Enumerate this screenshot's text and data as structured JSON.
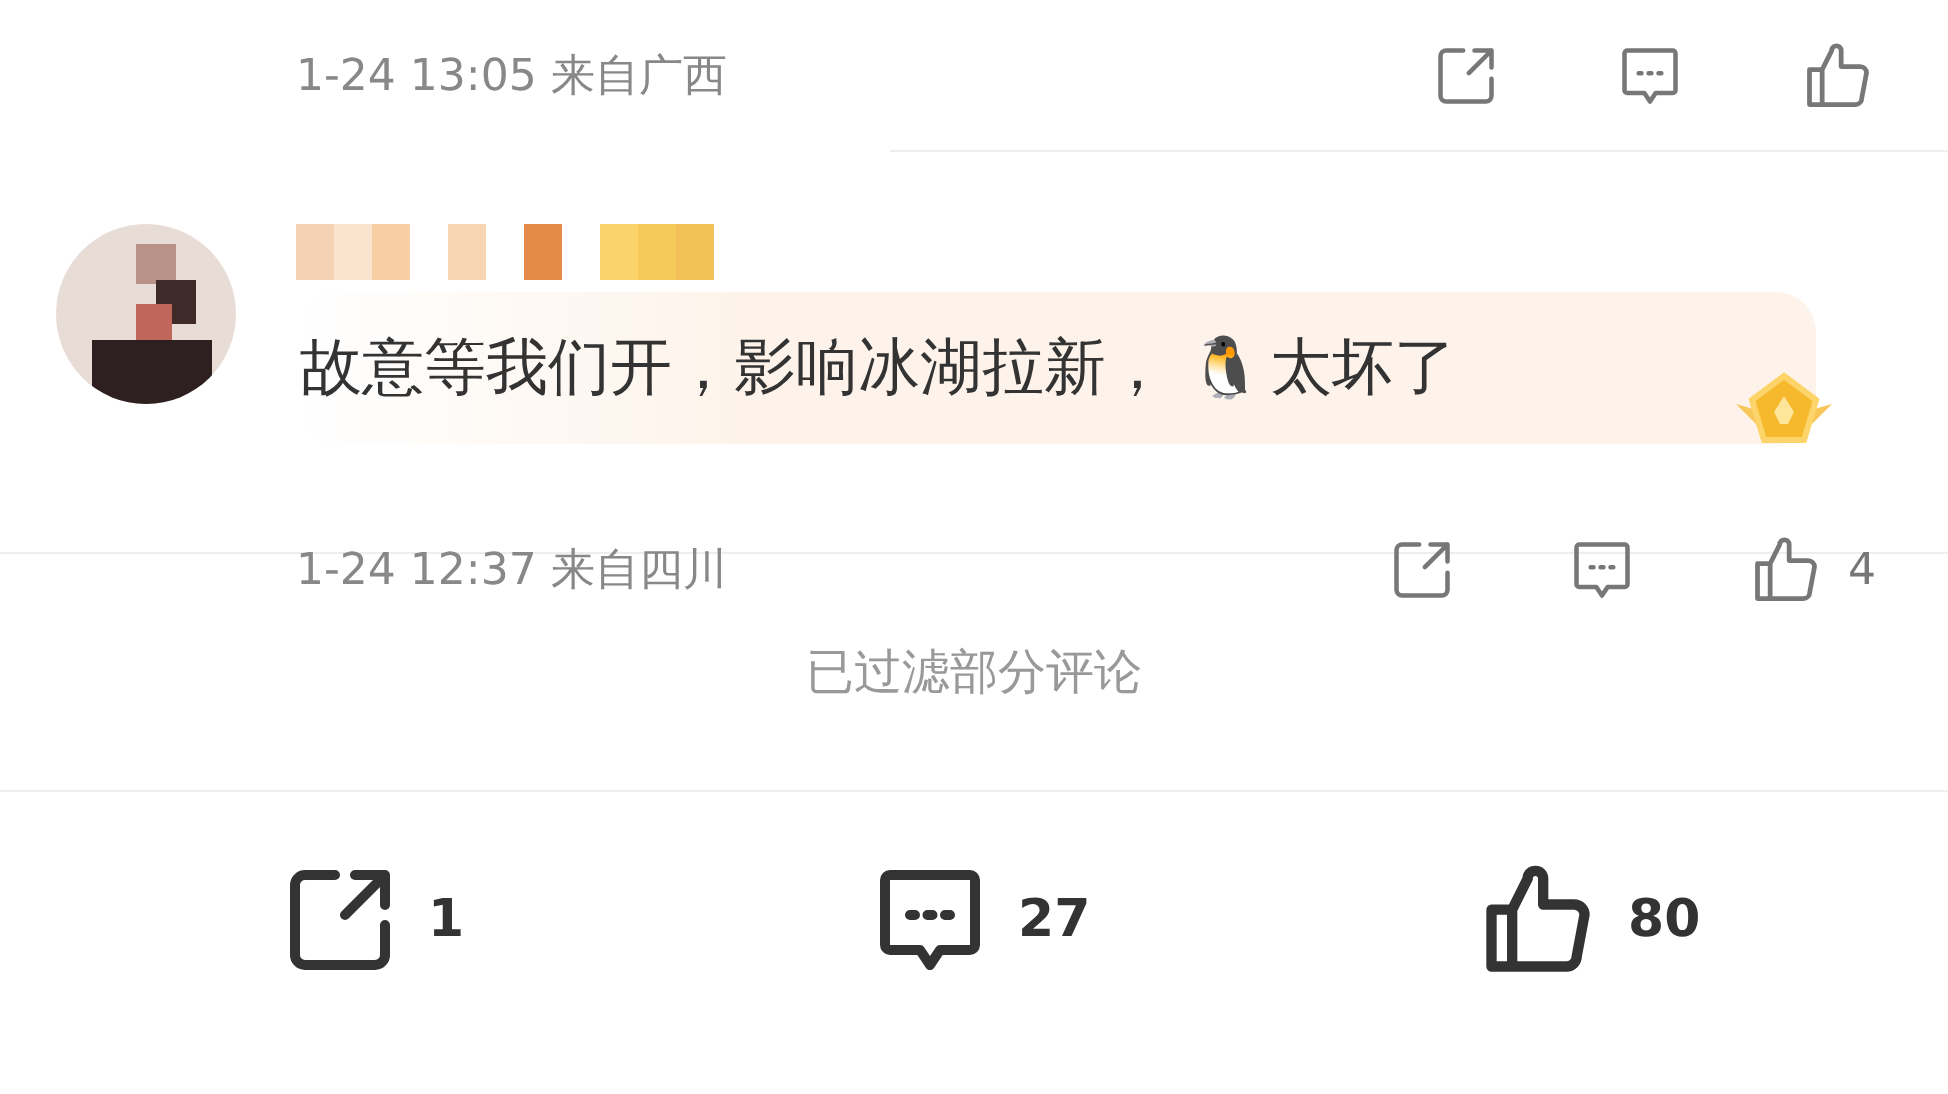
{
  "previous_comment": {
    "meta": "1-24 13:05 来自广西"
  },
  "comment": {
    "text": "故意等我们开，影响冰湖拉新，",
    "emoji": "🐧",
    "text_end": "太坏了",
    "meta": "1-24 12:37 来自四川",
    "like_count": "4"
  },
  "filter_notice": "已过滤部分评论",
  "bottom_bar": {
    "share_count": "1",
    "comment_count": "27",
    "like_count": "80"
  }
}
